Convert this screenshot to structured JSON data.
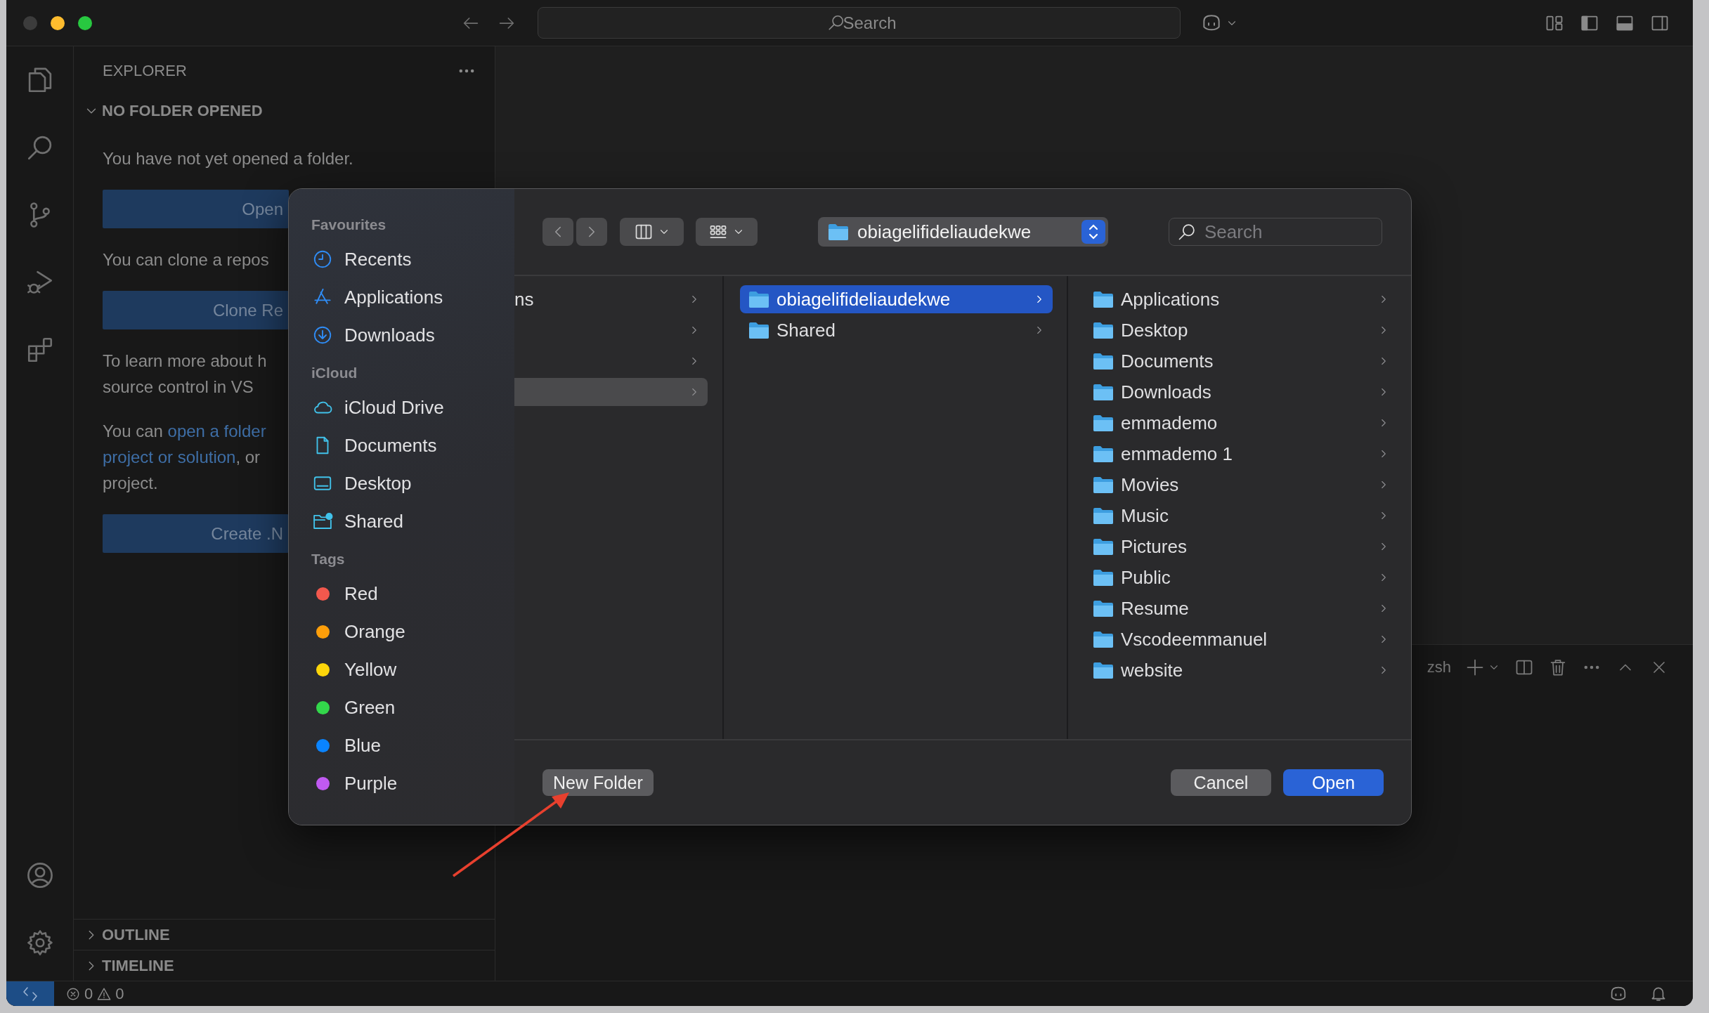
{
  "title_bar": {
    "search": {
      "placeholder": "Search"
    }
  },
  "explorer": {
    "title": "EXPLORER",
    "section": {
      "title": "NO FOLDER OPENED",
      "expanded": true
    },
    "content": [
      {
        "kind": "text",
        "lines": [
          [
            {
              "text": "You have not yet opened a folder."
            }
          ]
        ]
      },
      {
        "kind": "button",
        "label": "Open"
      },
      {
        "kind": "text",
        "lines": [
          [
            {
              "text": "You can clone a repos"
            }
          ]
        ]
      },
      {
        "kind": "button",
        "label": "Clone Re"
      },
      {
        "kind": "text",
        "lines": [
          [
            {
              "text": "To learn more about h"
            }
          ],
          [
            {
              "text": "source control in VS"
            }
          ]
        ]
      },
      {
        "kind": "text",
        "lines": [
          [
            {
              "text": "You can "
            },
            {
              "link": "open a folder"
            }
          ],
          [
            {
              "link": "project or solution"
            },
            {
              "text": ", or"
            }
          ],
          [
            {
              "text": "project."
            }
          ]
        ]
      },
      {
        "kind": "button",
        "label": "Create .N"
      }
    ],
    "bottom_sections": [
      {
        "title": "OUTLINE",
        "expanded": false
      },
      {
        "title": "TIMELINE",
        "expanded": false
      }
    ]
  },
  "terminal": {
    "shell": "zsh"
  },
  "status_bar": {
    "errors": "0",
    "warnings": "0"
  },
  "dialog": {
    "sidebar": [
      {
        "title": "Favourites",
        "items": [
          {
            "label": "Recents"
          },
          {
            "label": "Applications"
          },
          {
            "label": "Downloads"
          }
        ]
      },
      {
        "title": "iCloud",
        "items": [
          {
            "label": "iCloud Drive"
          },
          {
            "label": "Documents"
          },
          {
            "label": "Desktop"
          },
          {
            "label": "Shared"
          }
        ]
      },
      {
        "title": "Tags",
        "items": [
          {
            "label": "Red",
            "color": "#f2584d"
          },
          {
            "label": "Orange",
            "color": "#fe9f0a"
          },
          {
            "label": "Yellow",
            "color": "#fdd60a"
          },
          {
            "label": "Green",
            "color": "#33d74b"
          },
          {
            "label": "Blue",
            "color": "#0a84ff"
          },
          {
            "label": "Purple",
            "color": "#c05af2"
          }
        ]
      }
    ],
    "location": "obiagelifideliaudekwe",
    "search": {
      "placeholder": "Search"
    },
    "columns": [
      {
        "items": [
          {
            "kind": "cut",
            "label": "ns",
            "selected": false
          },
          {
            "kind": "cut",
            "selected": false
          },
          {
            "kind": "cut",
            "selected": false
          },
          {
            "kind": "cut",
            "selected": true
          }
        ]
      },
      {
        "items": [
          {
            "kind": "folder",
            "label": "obiagelifideliaudekwe",
            "selected": true
          },
          {
            "kind": "folder",
            "label": "Shared",
            "selected": false
          }
        ]
      },
      {
        "items": [
          {
            "kind": "folder",
            "label": "Applications",
            "selected": false
          },
          {
            "kind": "folder",
            "label": "Desktop",
            "selected": false
          },
          {
            "kind": "folder",
            "label": "Documents",
            "selected": false
          },
          {
            "kind": "folder",
            "label": "Downloads",
            "selected": false
          },
          {
            "kind": "folder",
            "label": "emmademo",
            "selected": false
          },
          {
            "kind": "folder",
            "label": "emmademo 1",
            "selected": false
          },
          {
            "kind": "folder",
            "label": "Movies",
            "selected": false
          },
          {
            "kind": "folder",
            "label": "Music",
            "selected": false
          },
          {
            "kind": "folder",
            "label": "Pictures",
            "selected": false
          },
          {
            "kind": "folder",
            "label": "Public",
            "selected": false
          },
          {
            "kind": "folder",
            "label": "Resume",
            "selected": false
          },
          {
            "kind": "folder",
            "label": "Vscodeemmanuel",
            "selected": false
          },
          {
            "kind": "folder",
            "label": "website",
            "selected": false
          }
        ]
      }
    ],
    "left_buttons": [
      {
        "label": "New Folder",
        "kind": "push"
      }
    ],
    "right_buttons": [
      {
        "label": "Cancel",
        "kind": "push"
      },
      {
        "label": "Open",
        "kind": "default"
      }
    ]
  }
}
